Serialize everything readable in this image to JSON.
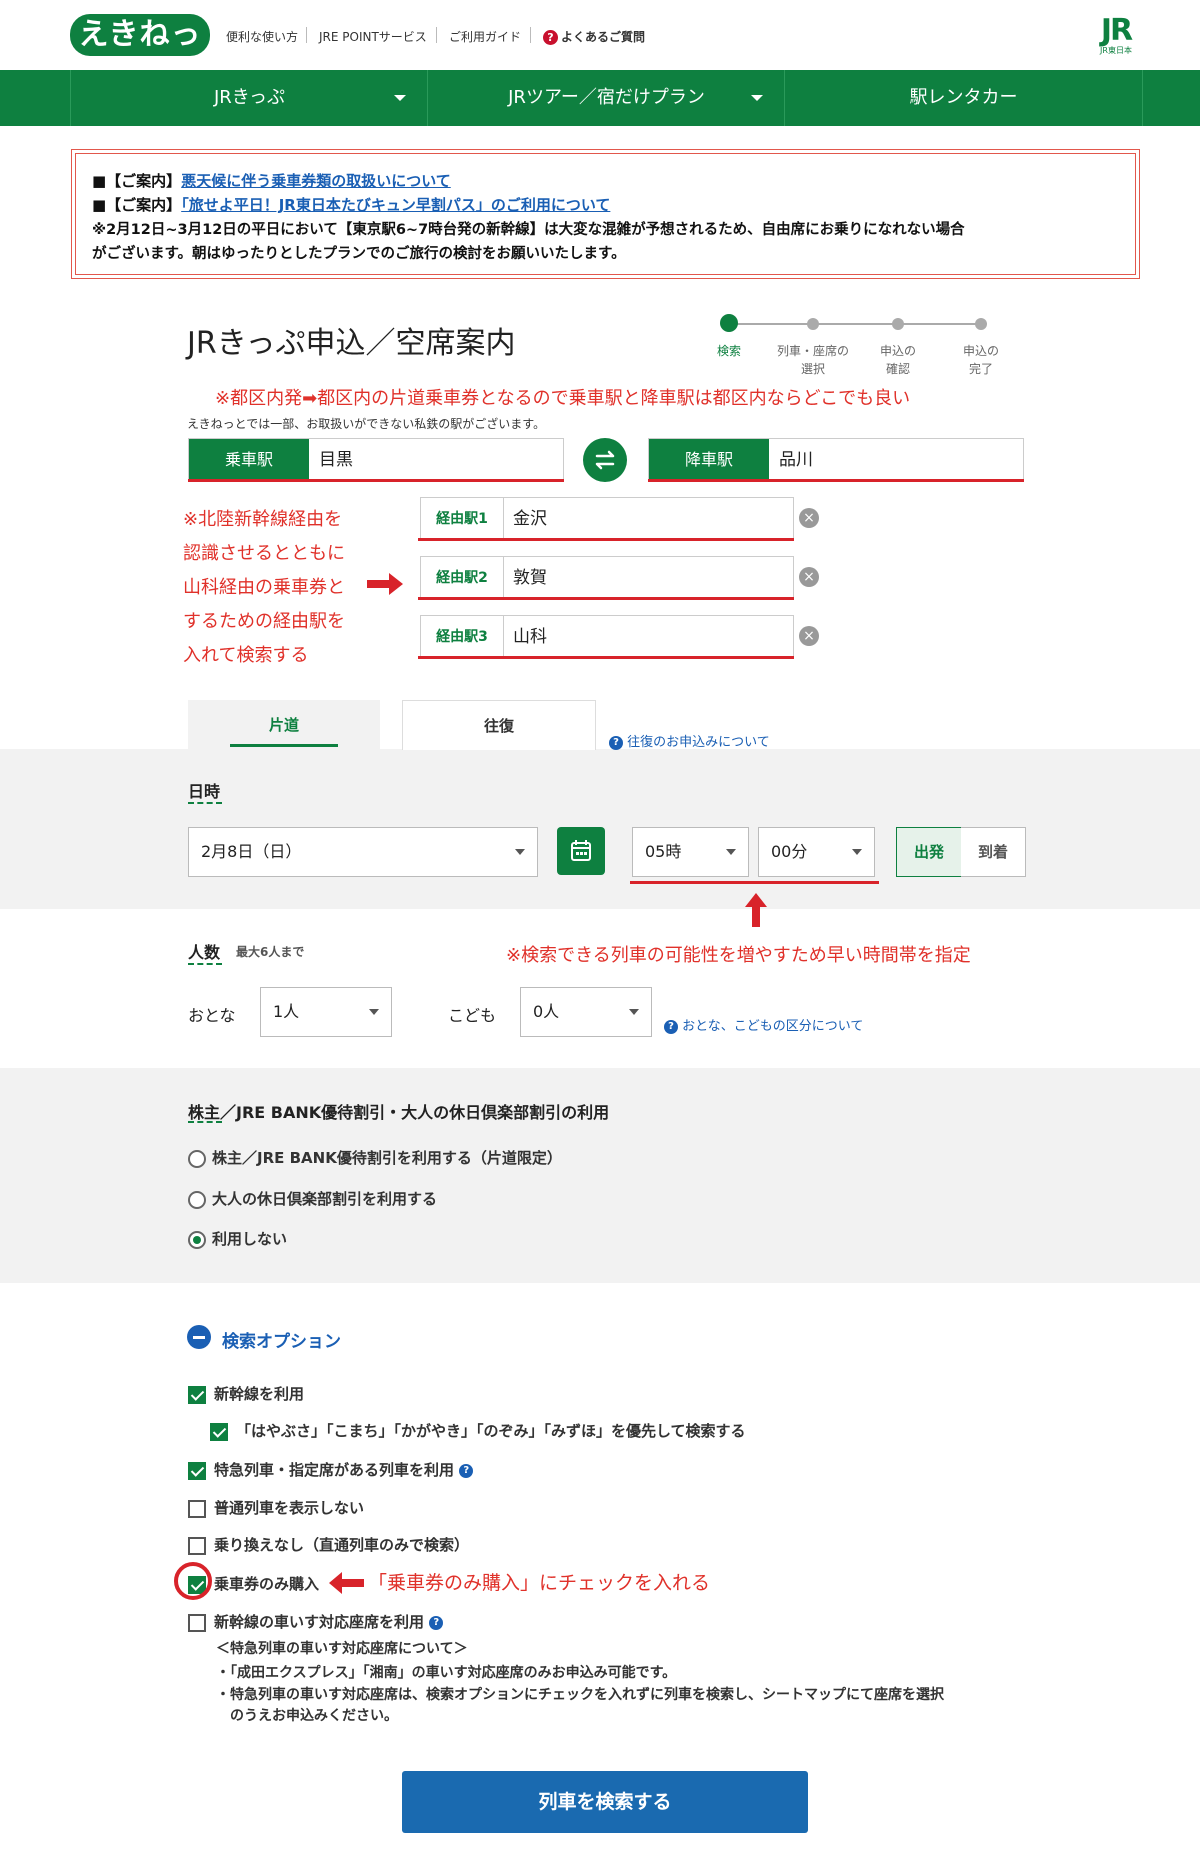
{
  "header": {
    "logo": "えきねっと",
    "links": [
      "便利な使い方",
      "JRE POINTサービス",
      "ご利用ガイド",
      "よくあるご質問"
    ],
    "brand_big": "JR",
    "brand_small": "JR東日本"
  },
  "nav": {
    "items": [
      "JRきっぷ",
      "JRツアー／宿だけプラン",
      "駅レンタカー"
    ]
  },
  "notice": {
    "line1_prefix": "■【ご案内】",
    "line1_link": "悪天候に伴う乗車券類の取扱いについて",
    "line2_prefix": "■【ご案内】",
    "line2_link": "「旅せよ平日！JR東日本たびキュン早割パス」のご利用について",
    "line3": "※2月12日~3月12日の平日において【東京駅6~7時台発の新幹線】は大変な混雑が予想されるため、自由席にお乗りになれない場合",
    "line4": "がございます。朝はゆったりとしたプランでのご旅行の検討をお願いいたします。"
  },
  "page": {
    "title": "JRきっぷ申込／空席案内"
  },
  "steps": [
    "検索",
    "列車・座席の\n選択",
    "申込の\n確認",
    "申込の\n完了"
  ],
  "steps_lines": [
    [
      "検索"
    ],
    [
      "列車・座席の",
      "選択"
    ],
    [
      "申込の",
      "確認"
    ],
    [
      "申込の",
      "完了"
    ]
  ],
  "annotations": {
    "top_note": "※都区内発➡都区内の片道乗車券となるので乗車駅と降車駅は都区内ならどこでも良い",
    "via_note": [
      "※北陸新幹線経由を",
      "認識させるとともに",
      "山科経由の乗車券と",
      "するための経由駅を",
      "入れて検索する"
    ],
    "time_note": "※検索できる列車の可能性を増やすため早い時間帯を指定",
    "ticket_note": "「乗車券のみ購入」にチェックを入れる"
  },
  "stations": {
    "disclaimer": "えきねっとでは一部、お取扱いができない私鉄の駅がございます。",
    "departure_label": "乗車駅",
    "departure_value": "目黒",
    "arrival_label": "降車駅",
    "arrival_value": "品川",
    "via": [
      {
        "label": "経由駅1",
        "value": "金沢"
      },
      {
        "label": "経由駅2",
        "value": "敦賀"
      },
      {
        "label": "経由駅3",
        "value": "山科"
      }
    ]
  },
  "tabs": {
    "one_way": "片道",
    "round_trip": "往復",
    "round_trip_help": "往復のお申込みについて"
  },
  "datetime": {
    "section": "日時",
    "date": "2月8日（日）",
    "hour": "05時",
    "minute": "00分",
    "depart": "出発",
    "arrive": "到着"
  },
  "passengers": {
    "section": "人数",
    "max": "最大6人まで",
    "adult_label": "おとな",
    "adult_value": "1人",
    "child_label": "こども",
    "child_value": "0人",
    "help": "おとな、こどもの区分について"
  },
  "discount": {
    "section": "株主／JRE BANK優待割引・大人の休日倶楽部割引の利用",
    "options": [
      "株主／JRE BANK優待割引を利用する（片道限定）",
      "大人の休日倶楽部割引を利用する",
      "利用しない"
    ],
    "selected_index": 2
  },
  "options": {
    "section": "検索オプション",
    "items": [
      {
        "label": "新幹線を利用",
        "checked": true
      },
      {
        "label": "「はやぶさ」「こまち」「かがやき」「のぞみ」「みずほ」を優先して検索する",
        "checked": true
      },
      {
        "label": "特急列車・指定席がある列車を利用",
        "checked": true
      },
      {
        "label": "普通列車を表示しない",
        "checked": false
      },
      {
        "label": "乗り換えなし（直通列車のみで検索）",
        "checked": false
      },
      {
        "label": "乗車券のみ購入",
        "checked": true
      },
      {
        "label": "新幹線の車いす対応座席を利用",
        "checked": false
      }
    ],
    "wheelchair_title": "＜特急列車の車いす対応座席について＞",
    "wheelchair_note1": "・「成田エクスプレス」「湘南」の車いす対応座席のみお申込み可能です。",
    "wheelchair_note2": "・特急列車の車いす対応座席は、検索オプションにチェックを入れずに列車を検索し、シートマップにて座席を選択",
    "wheelchair_note3": "　のうえお申込みください。"
  },
  "search_button": "列車を検索する",
  "colors": {
    "brand_green": "#0e8040",
    "annotation_red": "#e0312a",
    "link_blue": "#1a5fb4",
    "button_blue": "#1a6ab0"
  }
}
